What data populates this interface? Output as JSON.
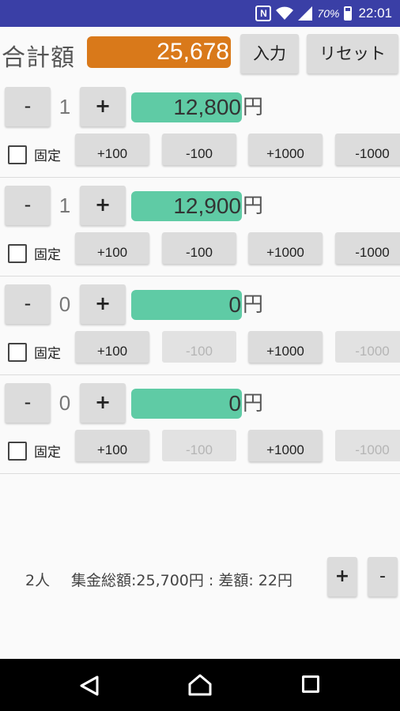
{
  "status_bar": {
    "nfc_icon": "N",
    "battery_percent": "70%",
    "time": "22:01"
  },
  "header": {
    "total_label": "合計額",
    "total_value": "25,678",
    "input_button": "入力",
    "reset_button": "リセット"
  },
  "rows": [
    {
      "minus": "-",
      "count": "1",
      "plus": "+",
      "amount": "12,800",
      "yen": "円",
      "fixed_label": "固定",
      "fixed_checked": false,
      "adjust": [
        {
          "label": "+100",
          "enabled": true
        },
        {
          "label": "-100",
          "enabled": true
        },
        {
          "label": "+1000",
          "enabled": true
        },
        {
          "label": "-1000",
          "enabled": true
        }
      ]
    },
    {
      "minus": "-",
      "count": "1",
      "plus": "+",
      "amount": "12,900",
      "yen": "円",
      "fixed_label": "固定",
      "fixed_checked": false,
      "adjust": [
        {
          "label": "+100",
          "enabled": true
        },
        {
          "label": "-100",
          "enabled": true
        },
        {
          "label": "+1000",
          "enabled": true
        },
        {
          "label": "-1000",
          "enabled": true
        }
      ]
    },
    {
      "minus": "-",
      "count": "0",
      "plus": "+",
      "amount": "0",
      "yen": "円",
      "fixed_label": "固定",
      "fixed_checked": false,
      "adjust": [
        {
          "label": "+100",
          "enabled": true
        },
        {
          "label": "-100",
          "enabled": false
        },
        {
          "label": "+1000",
          "enabled": true
        },
        {
          "label": "-1000",
          "enabled": false
        }
      ]
    },
    {
      "minus": "-",
      "count": "0",
      "plus": "+",
      "amount": "0",
      "yen": "円",
      "fixed_label": "固定",
      "fixed_checked": false,
      "adjust": [
        {
          "label": "+100",
          "enabled": true
        },
        {
          "label": "-100",
          "enabled": false
        },
        {
          "label": "+1000",
          "enabled": true
        },
        {
          "label": "-1000",
          "enabled": false
        }
      ]
    }
  ],
  "summary": {
    "people": "2人",
    "info": "集金総額:25,700円 : 差額: 22円",
    "plus": "+",
    "minus": "-"
  },
  "colors": {
    "status_bar": "#3a3fa6",
    "total_box": "#d9791a",
    "amount_box": "#5fcba5",
    "button": "#dcdcdc"
  },
  "icons": {
    "nav_back": "back-triangle-icon",
    "nav_home": "home-icon",
    "nav_recent": "recent-apps-icon"
  }
}
